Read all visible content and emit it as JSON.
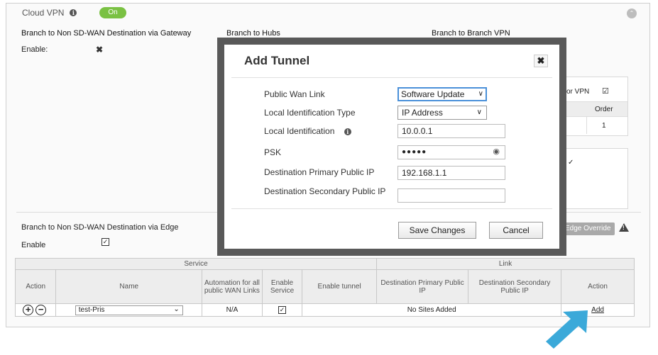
{
  "panel": {
    "title": "Cloud VPN",
    "toggle": "On",
    "col1_title": "Branch to Non SD-WAN Destination via Gateway",
    "col2_title": "Branch to Hubs",
    "col3_title": "Branch to Branch VPN",
    "enable_label": "Enable:",
    "right_vpn_label": "or VPN",
    "order_header": "Order",
    "order_value": "1",
    "edge_section_title": "Branch to Non SD-WAN Destination via Edge",
    "edge_enable_label": "Enable",
    "edge_override_label": "Edge Override"
  },
  "table": {
    "group_service": "Service",
    "group_link": "Link",
    "headers": {
      "action": "Action",
      "name": "Name",
      "automation": "Automation for all public WAN Links",
      "enable_service": "Enable Service",
      "enable_tunnel": "Enable tunnel",
      "dest_primary": "Destination Primary Public IP",
      "dest_secondary": "Destination Secondary Public IP",
      "action2": "Action"
    },
    "row": {
      "name": "test-Pris",
      "automation": "N/A",
      "no_sites": "No Sites Added",
      "add_link": "Add"
    }
  },
  "modal": {
    "title": "Add Tunnel",
    "fields": {
      "public_wan_link_label": "Public Wan Link",
      "public_wan_link_value": "Software Update",
      "local_id_type_label": "Local Identification Type",
      "local_id_type_value": "IP Address",
      "local_id_label": "Local Identification",
      "local_id_value": "10.0.0.1",
      "psk_label": "PSK",
      "psk_value": "●●●●●",
      "dest_primary_label": "Destination Primary Public IP",
      "dest_primary_value": "192.168.1.1",
      "dest_secondary_label": "Destination Secondary Public IP",
      "dest_secondary_value": ""
    },
    "save_label": "Save Changes",
    "cancel_label": "Cancel"
  },
  "icons": {
    "info": "info-icon",
    "close": "close-icon",
    "eye": "eye-icon",
    "chevron": "chevron-down-icon",
    "warning": "warning-icon",
    "arrow": "pointer-arrow"
  },
  "colors": {
    "toggle_on": "#7ac143",
    "arrow": "#3ba9d9",
    "focus": "#4a90d9",
    "modal_frame": "#595959"
  }
}
